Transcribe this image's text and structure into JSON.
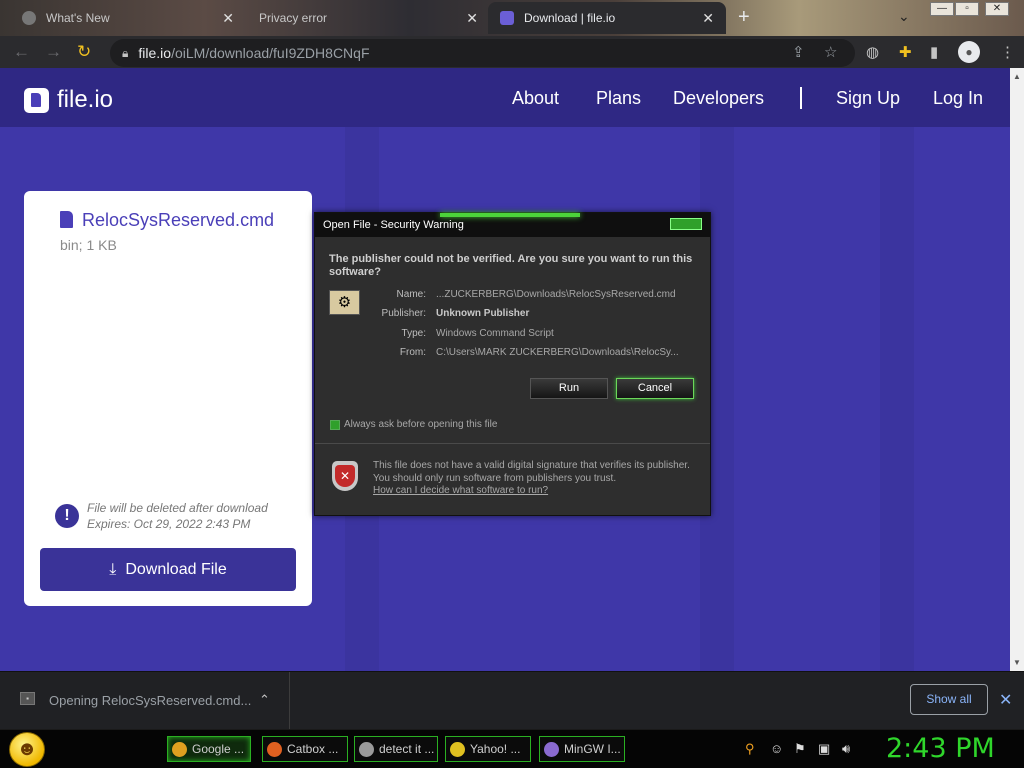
{
  "browser": {
    "tabs": [
      {
        "title": "What's New",
        "color": "#8a8a8a"
      },
      {
        "title": "Privacy error",
        "color": "#d0d0d0"
      },
      {
        "title": "Download | file.io",
        "color": "#6b5fd6"
      }
    ],
    "url_host": "file.io",
    "url_path": "/oiLM/download/fuI9ZDH8CNqF"
  },
  "site": {
    "brand": "file.io",
    "nav": {
      "about": "About",
      "plans": "Plans",
      "developers": "Developers",
      "signup": "Sign Up",
      "login": "Log In"
    }
  },
  "card": {
    "filename": "RelocSysReserved.cmd",
    "fileinfo": "bin; 1 KB",
    "notice_line1": "File will be deleted after download",
    "notice_line2": "Expires: Oct 29, 2022 2:43 PM",
    "download_label": "Download File"
  },
  "dialog": {
    "title": "Open File - Security Warning",
    "question": "The publisher could not be verified.  Are you sure you want to run this software?",
    "labels": {
      "name": "Name:",
      "publisher": "Publisher:",
      "type": "Type:",
      "from": "From:"
    },
    "values": {
      "name": "...ZUCKERBERG\\Downloads\\RelocSysReserved.cmd",
      "publisher": "Unknown Publisher",
      "type": "Windows Command Script",
      "from": "C:\\Users\\MARK ZUCKERBERG\\Downloads\\RelocSy..."
    },
    "run_label": "Run",
    "cancel_label": "Cancel",
    "checkbox_label": "Always ask before opening this file",
    "warning": "This file does not have a valid digital signature that verifies its publisher.  You should only run software from publishers you trust.",
    "link": "How can I decide what software to run?"
  },
  "shelf": {
    "item_text": "Opening RelocSysReserved.cmd...",
    "show_all": "Show all"
  },
  "taskbar": {
    "tasks": [
      {
        "label": "Google ...",
        "icon_color": "#e0a020"
      },
      {
        "label": "Catbox ...",
        "icon_color": "#e06020"
      },
      {
        "label": "detect it ...",
        "icon_color": "#9a9a9a"
      },
      {
        "label": "Yahoo! ...",
        "icon_color": "#e0c020"
      },
      {
        "label": "MinGW I...",
        "icon_color": "#8a6ad0"
      }
    ],
    "clock": "2:43 PM"
  },
  "colors": {
    "brand": "#3f37a8",
    "header": "#2f2884",
    "accent_green": "#2fd62b"
  }
}
